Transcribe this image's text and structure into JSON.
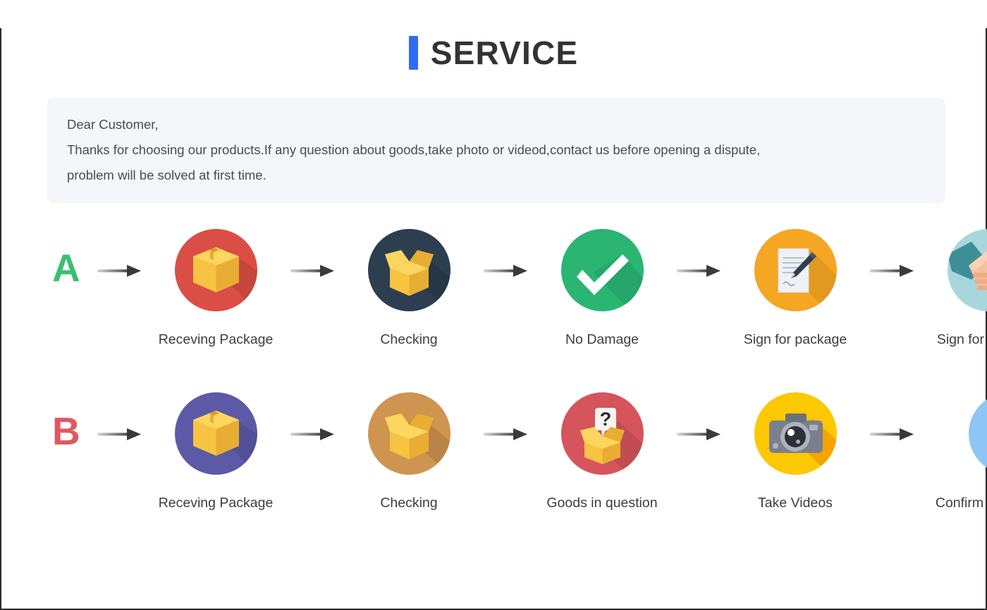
{
  "header": {
    "title": "SERVICE",
    "accent_color": "#2f6df6"
  },
  "notice": {
    "line1": "Dear Customer,",
    "line2": "Thanks for choosing our products.If any question about goods,take photo or videod,contact us before opening a dispute,",
    "line3": "problem will be solved at first time.",
    "background_color": "#f5f6fa"
  },
  "flows": [
    {
      "letter": "A",
      "letter_color": "#3bbf72",
      "steps": [
        {
          "icon": "package-box-icon",
          "circle_color": "#db4e45",
          "label": "Receving Package"
        },
        {
          "icon": "open-box-icon",
          "circle_color": "#2c3e50",
          "label": "Checking"
        },
        {
          "icon": "checkmark-icon",
          "circle_color": "#2ab573",
          "label": "No Damage"
        },
        {
          "icon": "sign-document-icon",
          "circle_color": "#f5a623",
          "label": "Sign for package"
        },
        {
          "icon": "handshake-icon",
          "circle_color": "#a7d6dc",
          "label": "Sign for package"
        }
      ]
    },
    {
      "letter": "B",
      "letter_color": "#e2575f",
      "steps": [
        {
          "icon": "package-box-icon",
          "circle_color": "#5c5aa7",
          "label": "Receving Package"
        },
        {
          "icon": "open-box-icon",
          "circle_color": "#cf9450",
          "label": "Checking"
        },
        {
          "icon": "question-box-icon",
          "circle_color": "#d6545c",
          "label": "Goods in question"
        },
        {
          "icon": "camera-icon",
          "circle_color": "#fcc800",
          "label": "Take Videos"
        },
        {
          "icon": "support-agent-icon",
          "circle_color": "#8dc6f5",
          "label": "Confirm  problem,refund money"
        }
      ]
    }
  ],
  "arrow": {
    "name": "arrow-right-icon",
    "color_light": "#cfcfcf",
    "color_dark": "#3c3c3c"
  }
}
